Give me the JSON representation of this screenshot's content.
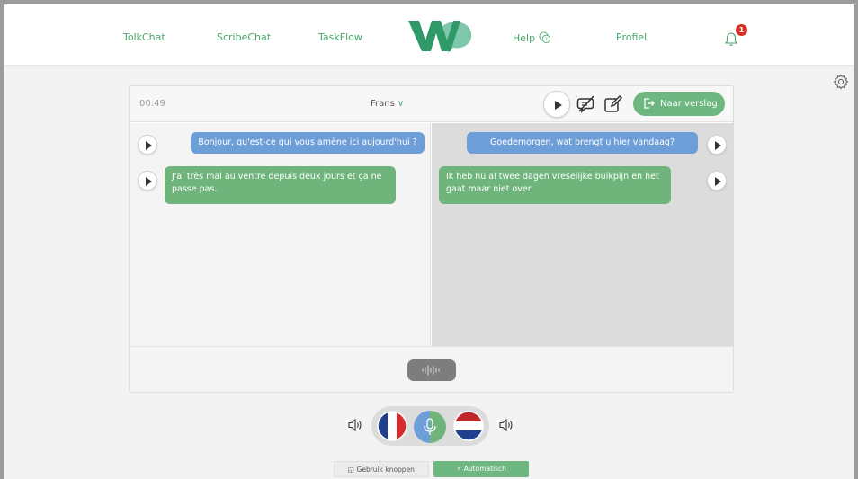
{
  "nav": {
    "items": [
      {
        "label": "TolkChat"
      },
      {
        "label": "ScribeChat"
      },
      {
        "label": "TaskFlow"
      },
      {
        "label": "Help"
      },
      {
        "label": "Profiel"
      }
    ],
    "notification_count": "1"
  },
  "toolbar": {
    "timer": "00:49",
    "language": "Frans",
    "report_label": "Naar verslag"
  },
  "conversation": {
    "left": [
      {
        "text": "Bonjour, qu'est-ce qui vous amène ici aujourd'hui ?",
        "color": "#6e9ed8"
      },
      {
        "text": "J'ai très mal au ventre depuis deux jours et ça ne passe pas.",
        "color": "#6fb57b"
      }
    ],
    "right": [
      {
        "text": "Goedemorgen, wat brengt u hier vandaag?",
        "color": "#6e9ed8"
      },
      {
        "text": "Ik heb nu al twee dagen vreselijke buikpijn en het gaat maar niet over.",
        "color": "#6fb57b"
      }
    ]
  },
  "languages": {
    "left_flag": "flag-france-icon",
    "right_flag": "flag-netherlands-icon"
  },
  "modes": {
    "manual_label": "Gebruik knoppen",
    "auto_label": "Automatisch"
  },
  "colors": {
    "accent": "#4aa56a",
    "button_green": "#6fb780",
    "bubble_blue": "#6e9ed8",
    "bubble_green": "#6fb57b",
    "badge_red": "#d63024"
  }
}
